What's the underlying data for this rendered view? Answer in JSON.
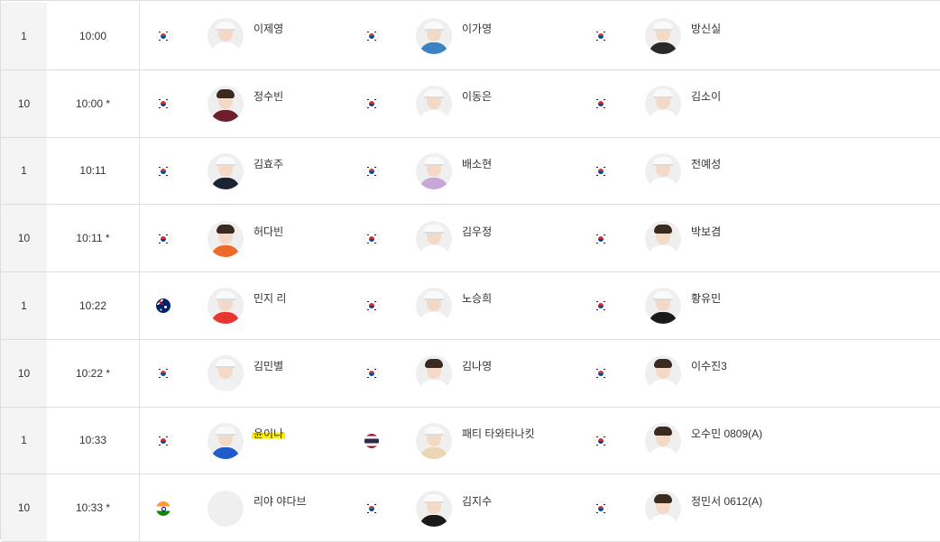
{
  "rows": [
    {
      "hole": "1",
      "time": "10:00",
      "players": [
        {
          "flag": "kr",
          "name": "이제영",
          "body": "#ffffff",
          "cap": true
        },
        {
          "flag": "kr",
          "name": "이가영",
          "body": "#3b82c4",
          "cap": true
        },
        {
          "flag": "kr",
          "name": "방신실",
          "body": "#2a2a2a",
          "cap": true
        }
      ]
    },
    {
      "hole": "10",
      "time": "10:00 *",
      "players": [
        {
          "flag": "kr",
          "name": "정수빈",
          "body": "#6e1f2a",
          "cap": false
        },
        {
          "flag": "kr",
          "name": "이동은",
          "body": "#ffffff",
          "cap": true
        },
        {
          "flag": "kr",
          "name": "김소이",
          "body": "#ffffff",
          "cap": true
        }
      ]
    },
    {
      "hole": "1",
      "time": "10:11",
      "players": [
        {
          "flag": "kr",
          "name": "김효주",
          "body": "#1c2333",
          "cap": true
        },
        {
          "flag": "kr",
          "name": "배소현",
          "body": "#c9a6d8",
          "cap": true
        },
        {
          "flag": "kr",
          "name": "전예성",
          "body": "#ffffff",
          "cap": true
        }
      ]
    },
    {
      "hole": "10",
      "time": "10:11 *",
      "players": [
        {
          "flag": "kr",
          "name": "허다빈",
          "body": "#ee6a2a",
          "cap": false
        },
        {
          "flag": "kr",
          "name": "김우정",
          "body": "#ffffff",
          "cap": true
        },
        {
          "flag": "kr",
          "name": "박보겸",
          "body": "#ffffff",
          "cap": false
        }
      ]
    },
    {
      "hole": "1",
      "time": "10:22",
      "players": [
        {
          "flag": "au",
          "name": "민지 리",
          "body": "#e8352f",
          "cap": true
        },
        {
          "flag": "kr",
          "name": "노승희",
          "body": "#ffffff",
          "cap": true
        },
        {
          "flag": "kr",
          "name": "황유민",
          "body": "#1a1a1a",
          "cap": true
        }
      ]
    },
    {
      "hole": "10",
      "time": "10:22 *",
      "players": [
        {
          "flag": "kr",
          "name": "김민별",
          "body": "#f2f2f2",
          "cap": true
        },
        {
          "flag": "kr",
          "name": "김나영",
          "body": "#ffffff",
          "cap": false
        },
        {
          "flag": "kr",
          "name": "이수진3",
          "body": "#ffffff",
          "cap": false
        }
      ]
    },
    {
      "hole": "1",
      "time": "10:33",
      "players": [
        {
          "flag": "kr",
          "name": "윤이나",
          "body": "#1f5bc9",
          "cap": true,
          "highlight": true
        },
        {
          "flag": "th",
          "name": "패티 타와타나킷",
          "body": "#e9d6b4",
          "cap": true
        },
        {
          "flag": "kr",
          "name": "오수민 0809(A)",
          "body": "#ffffff",
          "cap": false
        }
      ]
    },
    {
      "hole": "10",
      "time": "10:33 *",
      "players": [
        {
          "flag": "in",
          "name": "리야 야다브",
          "body": "#efefef",
          "cap": false,
          "empty": true
        },
        {
          "flag": "kr",
          "name": "김지수",
          "body": "#1a1a1a",
          "cap": true
        },
        {
          "flag": "kr",
          "name": "정민서 0612(A)",
          "body": "#ffffff",
          "cap": false
        }
      ]
    }
  ]
}
